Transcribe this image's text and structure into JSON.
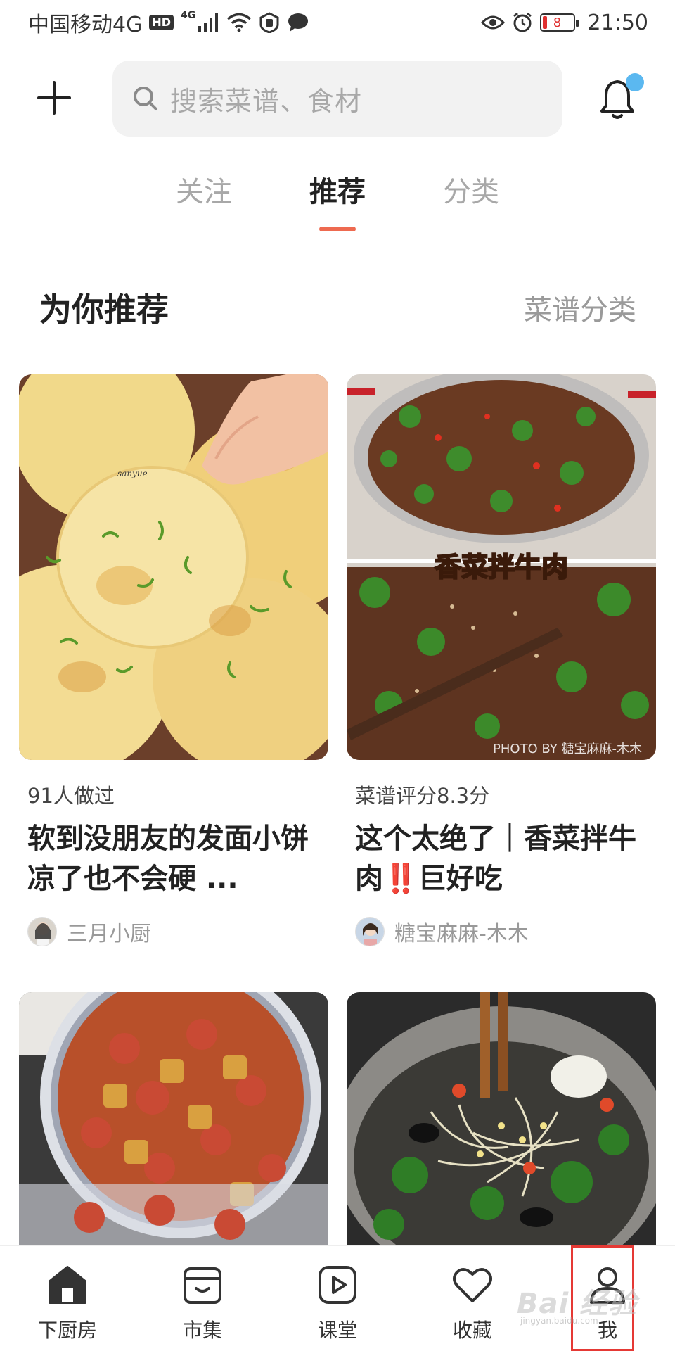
{
  "status_bar": {
    "carrier": "中国移动4G",
    "hd": "HD",
    "signal_gen": "4G",
    "battery": "8",
    "time": "21:50"
  },
  "header": {
    "search_placeholder": "搜索菜谱、食材"
  },
  "tabs": [
    {
      "label": "关注",
      "active": false
    },
    {
      "label": "推荐",
      "active": true
    },
    {
      "label": "分类",
      "active": false
    }
  ],
  "section": {
    "title": "为你推荐",
    "link": "菜谱分类"
  },
  "cards": [
    {
      "meta": "91人做过",
      "title": "软到没朋友的发面小饼 凉了也不会硬 ...",
      "author": "三月小厨",
      "image_text": "sanyue"
    },
    {
      "meta": "菜谱评分8.3分",
      "title": "这个太绝了｜香菜拌牛肉‼️巨好吃",
      "author": "糖宝麻麻-木木",
      "image_text": "香菜拌牛肉",
      "image_credit": "PHOTO BY 糖宝麻麻-木木"
    }
  ],
  "nav": [
    {
      "label": "下厨房",
      "icon": "home-icon"
    },
    {
      "label": "市集",
      "icon": "market-icon"
    },
    {
      "label": "课堂",
      "icon": "play-icon"
    },
    {
      "label": "收藏",
      "icon": "heart-icon"
    },
    {
      "label": "我",
      "icon": "user-icon"
    }
  ],
  "watermark": {
    "text": "Bai 经验",
    "sub": "jingyan.baidu.com"
  },
  "colors": {
    "accent": "#ee6a50",
    "notification_dot": "#5bb8f0",
    "highlight": "#e53935"
  }
}
